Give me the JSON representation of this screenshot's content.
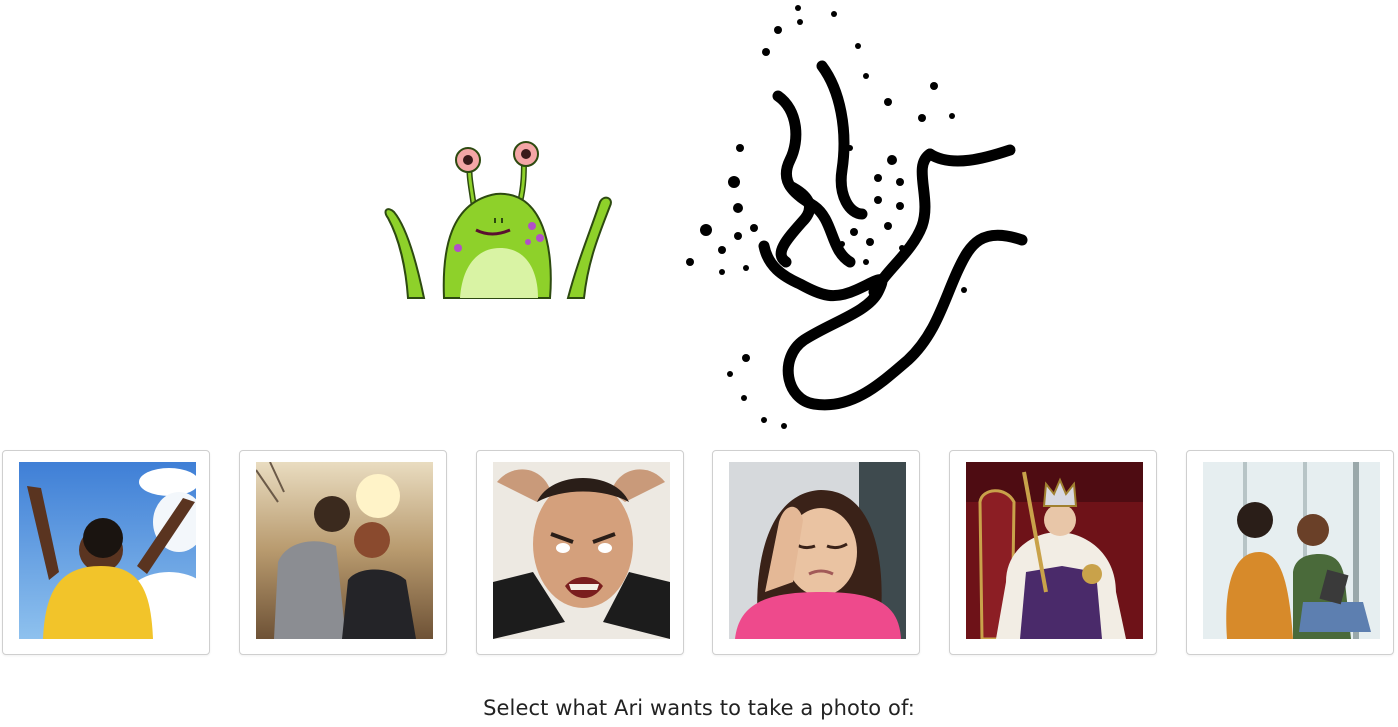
{
  "character": {
    "name": "Ari",
    "icon": "green-alien"
  },
  "photo_options": [
    {
      "id": "joy",
      "icon": "joyful-woman-photo"
    },
    {
      "id": "romance",
      "icon": "couple-kiss-photo"
    },
    {
      "id": "anger",
      "icon": "angry-man-photo"
    },
    {
      "id": "sadness",
      "icon": "sad-woman-photo"
    },
    {
      "id": "royalty",
      "icon": "king-photo"
    },
    {
      "id": "conversation",
      "icon": "two-women-talking-photo"
    }
  ],
  "prompt": "Select what Ari wants to take a photo of:",
  "colors": {
    "card_border": "#cfcfcf",
    "alien_green": "#8ed12a",
    "text": "#222222"
  }
}
